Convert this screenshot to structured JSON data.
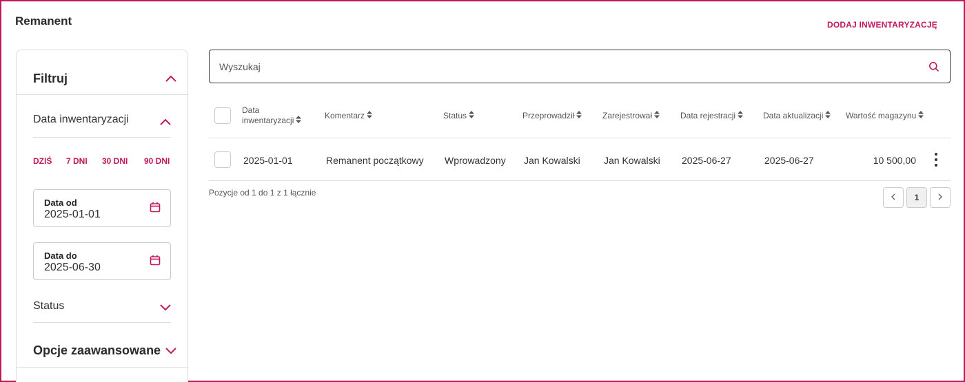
{
  "header": {
    "title": "Remanent",
    "add_button": "DODAJ INWENTARYZACJĘ"
  },
  "sidebar": {
    "filter_title": "Filtruj",
    "date_section": {
      "title": "Data inwentaryzacji",
      "quick_ranges": [
        "DZIŚ",
        "7 DNI",
        "30 DNI",
        "90 DNI"
      ],
      "from": {
        "label": "Data od",
        "value": "2025-01-01"
      },
      "to": {
        "label": "Data do",
        "value": "2025-06-30"
      }
    },
    "status_section": {
      "title": "Status"
    },
    "advanced_section": {
      "title": "Opcje zaawansowane"
    }
  },
  "search": {
    "placeholder": "Wyszukaj"
  },
  "table": {
    "columns": {
      "date_line1": "Data",
      "date_line2": "inwentaryzacji",
      "comment": "Komentarz",
      "status": "Status",
      "performed_by": "Przeprowadził",
      "registered_by": "Zarejestrował",
      "registration_date": "Data rejestracji",
      "update_date": "Data aktualizacji",
      "stock_value": "Wartość magazynu"
    },
    "rows": [
      {
        "date": "2025-01-01",
        "comment": "Remanent początkowy",
        "status": "Wprowadzony",
        "performed_by": "Jan Kowalski",
        "registered_by": "Jan Kowalski",
        "registration_date": "2025-06-27",
        "update_date": "2025-06-27",
        "stock_value": "10 500,00"
      }
    ]
  },
  "pagination": {
    "summary": "Pozycje od 1 do 1 z 1 łącznie",
    "current_page": "1"
  },
  "colors": {
    "accent": "#c2185b",
    "border": "#dddddd",
    "text": "#333333"
  }
}
